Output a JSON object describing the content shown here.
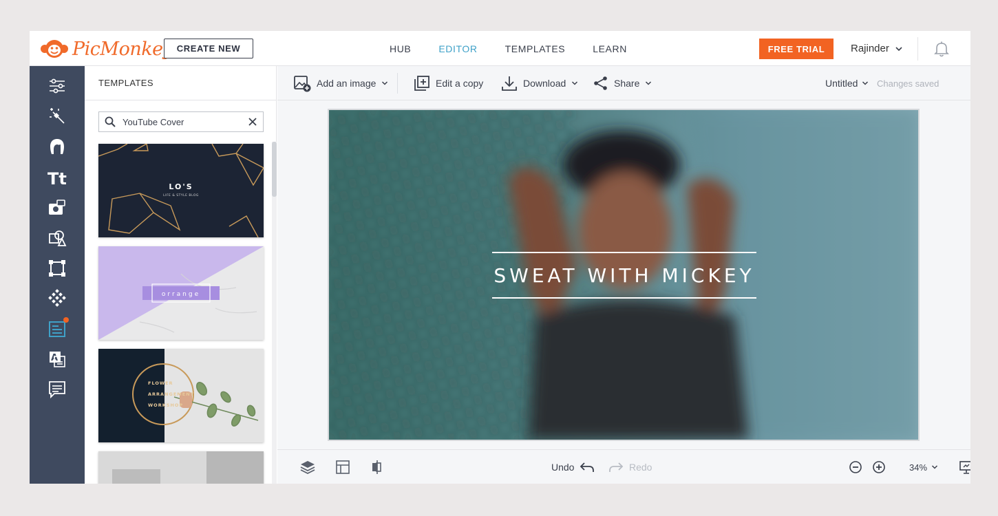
{
  "header": {
    "logo_text": "PicMonkey",
    "create_new_label": "CREATE NEW",
    "nav": [
      {
        "label": "HUB",
        "active": false
      },
      {
        "label": "EDITOR",
        "active": true
      },
      {
        "label": "TEMPLATES",
        "active": false
      },
      {
        "label": "LEARN",
        "active": false
      }
    ],
    "free_trial_label": "FREE TRIAL",
    "user_name": "Rajinder",
    "icons": {
      "user_menu": "chevron-down-icon",
      "notifications": "bell-icon"
    }
  },
  "rail": {
    "items": [
      {
        "icon": "adjustments-icon"
      },
      {
        "icon": "magic-wand-icon"
      },
      {
        "icon": "touch-up-face-icon"
      },
      {
        "icon": "text-icon"
      },
      {
        "icon": "add-photo-icon"
      },
      {
        "icon": "graphics-shapes-icon"
      },
      {
        "icon": "frames-icon"
      },
      {
        "icon": "textures-icon"
      },
      {
        "icon": "templates-icon",
        "active": true,
        "badge": true
      },
      {
        "icon": "themes-icon"
      },
      {
        "icon": "comments-icon"
      }
    ]
  },
  "templates_panel": {
    "title": "TEMPLATES",
    "search": {
      "value": "YouTube Cover",
      "icon": "search-icon",
      "clear_icon": "close-icon"
    },
    "thumbnails": [
      {
        "title": "LO'S",
        "subtitle": "LIFE & STYLE BLOG"
      },
      {
        "title": "orrange"
      },
      {
        "lines": [
          "FLOWER",
          "ARRANGEMENT",
          "WORKSHOP"
        ]
      },
      {}
    ]
  },
  "toolbar": {
    "add_image": {
      "label": "Add an image",
      "icon": "add-image-icon"
    },
    "edit_copy": {
      "label": "Edit a copy",
      "icon": "copy-icon"
    },
    "download": {
      "label": "Download",
      "icon": "download-icon"
    },
    "share": {
      "label": "Share",
      "icon": "share-icon"
    },
    "document_name": "Untitled",
    "save_status": "Changes saved"
  },
  "canvas": {
    "title_text": "SWEAT WITH MICKEY"
  },
  "bottombar": {
    "layers_icon": "layers-icon",
    "grid_icon": "grid-icon",
    "align_icon": "align-icon",
    "undo_label": "Undo",
    "redo_label": "Redo",
    "zoom_out_icon": "zoom-out-icon",
    "zoom_in_icon": "zoom-in-icon",
    "zoom_value": "34%",
    "present_icon": "presentation-icon"
  },
  "colors": {
    "brand_orange": "#f26322",
    "active_blue": "#3fa1c8",
    "rail_bg": "#3f4a5f"
  }
}
